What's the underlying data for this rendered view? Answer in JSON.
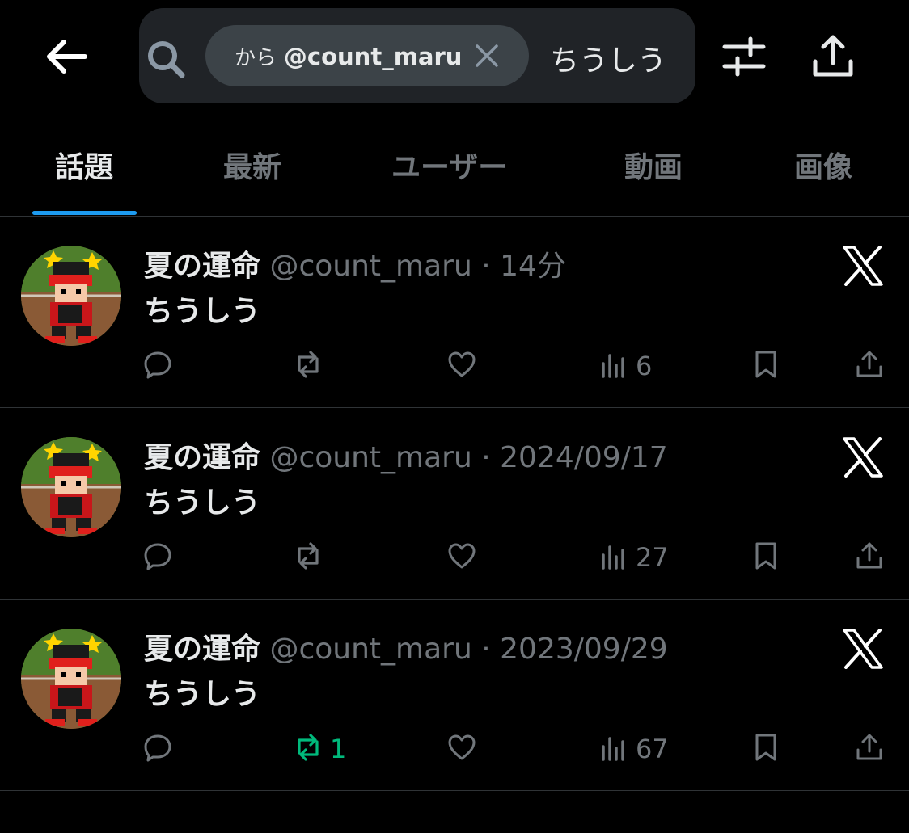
{
  "search": {
    "chip_prefix": "から",
    "chip_handle": "@count_maru",
    "query": "ちうしう"
  },
  "tabs": [
    {
      "label": "話題",
      "active": true
    },
    {
      "label": "最新",
      "active": false
    },
    {
      "label": "ユーザー",
      "active": false
    },
    {
      "label": "動画",
      "active": false
    },
    {
      "label": "画像",
      "active": false
    }
  ],
  "posts": [
    {
      "display_name": "夏の運命",
      "handle": "@count_maru",
      "separator": "·",
      "time": "14分",
      "text": "ちうしう",
      "reply_count": "",
      "retweet_count": "",
      "like_count": "",
      "view_count": "6",
      "retweeted": false
    },
    {
      "display_name": "夏の運命",
      "handle": "@count_maru",
      "separator": "·",
      "time": "2024/09/17",
      "text": "ちうしう",
      "reply_count": "",
      "retweet_count": "",
      "like_count": "",
      "view_count": "27",
      "retweeted": false
    },
    {
      "display_name": "夏の運命",
      "handle": "@count_maru",
      "separator": "·",
      "time": "2023/09/29",
      "text": "ちうしう",
      "reply_count": "",
      "retweet_count": "1",
      "like_count": "",
      "view_count": "67",
      "retweeted": true
    }
  ],
  "icons": {
    "back": "arrow-left-icon",
    "search": "search-icon",
    "close": "close-icon",
    "filter": "sliders-icon",
    "share": "share-icon",
    "brand": "x-logo-icon",
    "reply": "reply-icon",
    "retweet": "retweet-icon",
    "like": "heart-icon",
    "views": "views-icon",
    "bookmark": "bookmark-icon"
  },
  "colors": {
    "background": "#000000",
    "muted": "#71767b",
    "text": "#e7e9ea",
    "accent": "#1d9bf0",
    "retweet_active": "#00ba7c"
  }
}
